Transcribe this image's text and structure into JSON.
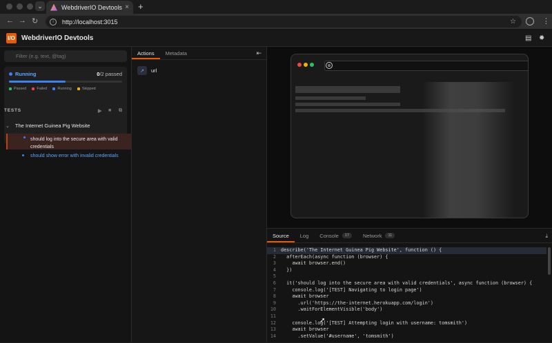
{
  "browser": {
    "tab_title": "WebdriverIO Devtools",
    "tab_close": "×",
    "new_tab": "+",
    "dropdown": "⌄",
    "url": "http://localhost:3015",
    "nav_back": "←",
    "nav_forward": "→",
    "nav_reload": "↻",
    "star": "☆",
    "menu": "⋮"
  },
  "app": {
    "logo_text": "I/O",
    "title": "WebdriverIO Devtools"
  },
  "sidebar": {
    "filter_placeholder": "Filter (e.g. text, @tag)",
    "status": {
      "label": "Running",
      "passed_count": "0",
      "passed_total": "/2 passed",
      "progress": 0.5
    },
    "legend": [
      {
        "label": "Passed",
        "color": "#22c55e"
      },
      {
        "label": "Failed",
        "color": "#ef4444"
      },
      {
        "label": "Running",
        "color": "#3b82f6"
      },
      {
        "label": "Skipped",
        "color": "#eab308"
      }
    ],
    "tests_heading": "TESTS",
    "suite_title": "The Internet Guinea Pig Website",
    "tests": [
      {
        "title": "should log into the secure area with valid credentials",
        "state": "running"
      },
      {
        "title": "should show error with invalid credentials",
        "state": "pending"
      }
    ]
  },
  "actions_panel": {
    "tabs": [
      "Actions",
      "Metadata"
    ],
    "items": [
      {
        "label": "url",
        "icon": "↗"
      }
    ]
  },
  "bottom_panel": {
    "tabs": [
      {
        "label": "Source",
        "badge": ""
      },
      {
        "label": "Log",
        "badge": ""
      },
      {
        "label": "Console",
        "badge": "17"
      },
      {
        "label": "Network",
        "badge": "11"
      }
    ],
    "code": [
      {
        "n": "1",
        "text": "describe('The Internet Guinea Pig Website', function () {"
      },
      {
        "n": "2",
        "text": "  afterEach(async function (browser) {"
      },
      {
        "n": "3",
        "text": "    await browser.end()"
      },
      {
        "n": "4",
        "text": "  })"
      },
      {
        "n": "5",
        "text": ""
      },
      {
        "n": "6",
        "text": "  it('should log into the secure area with valid credentials', async function (browser) {"
      },
      {
        "n": "7",
        "text": "    console.log('[TEST] Navigating to login page')"
      },
      {
        "n": "8",
        "text": "    await browser"
      },
      {
        "n": "9",
        "text": "      .url('https://the-internet.herokuapp.com/login')"
      },
      {
        "n": "10",
        "text": "      .waitForElementVisible('body')"
      },
      {
        "n": "11",
        "text": ""
      },
      {
        "n": "12",
        "text": "    console.log('[TEST] Attempting login with username: tomsmith')"
      },
      {
        "n": "13",
        "text": "    await browser"
      },
      {
        "n": "14",
        "text": "      .setValue('#username', 'tomsmith')"
      }
    ]
  }
}
